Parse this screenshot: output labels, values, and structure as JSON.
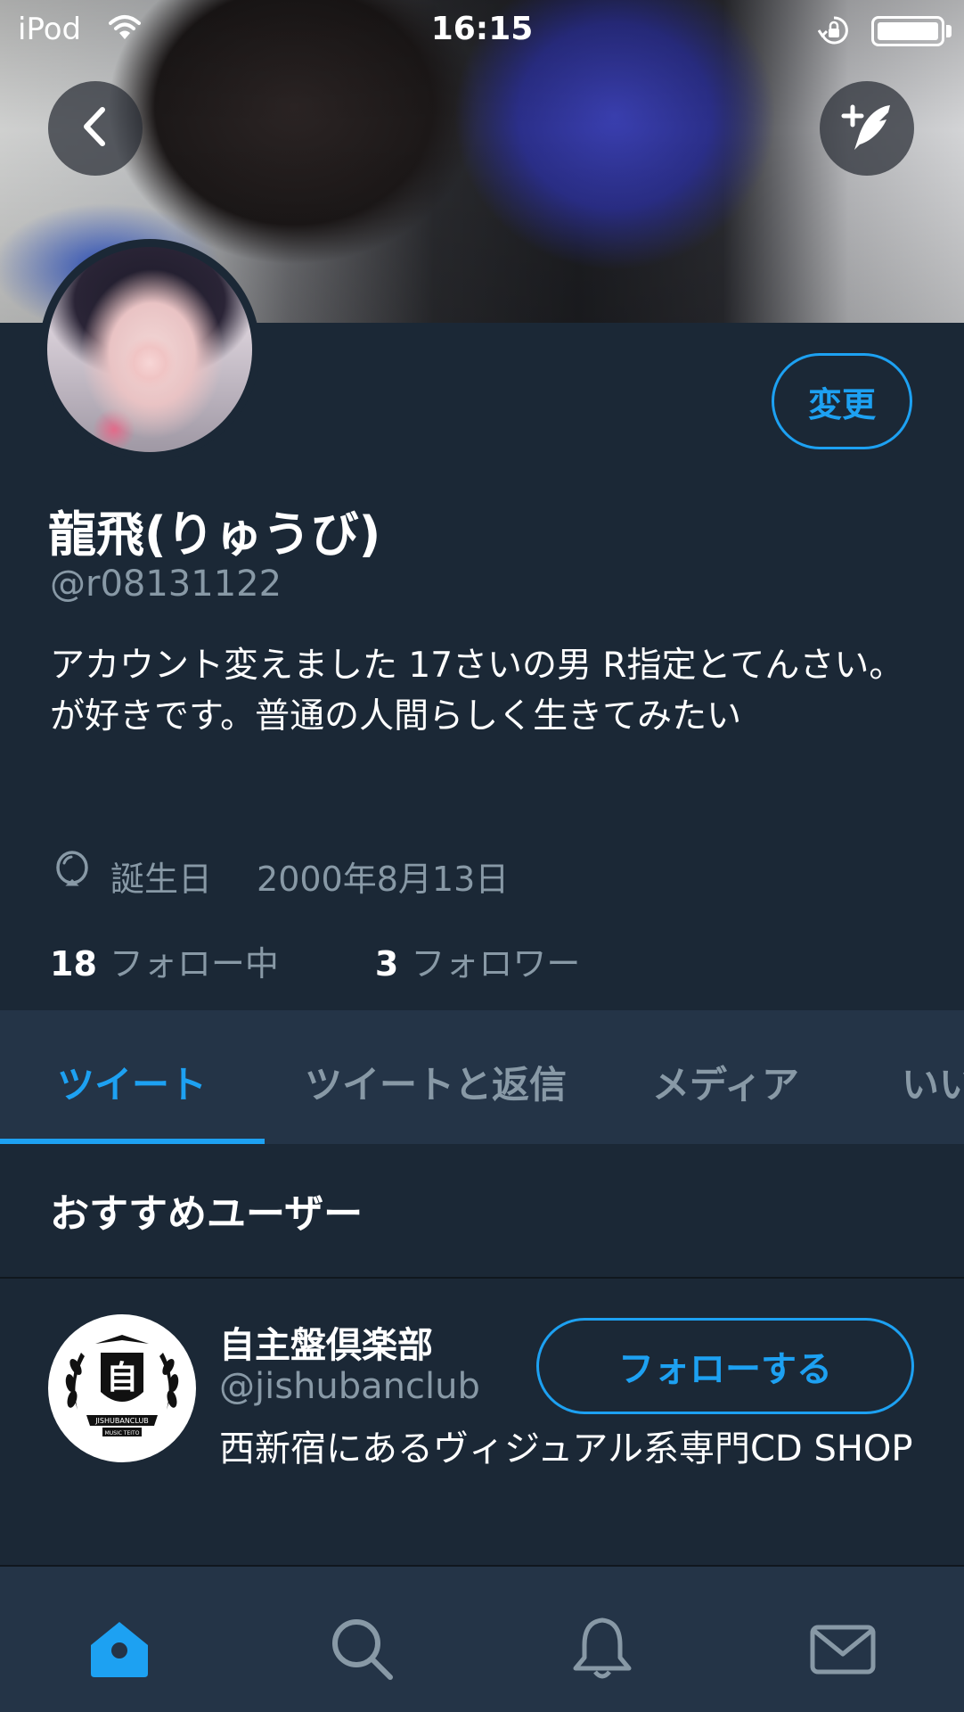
{
  "status_bar": {
    "carrier": "iPod",
    "time": "16:15"
  },
  "header": {
    "back_icon": "chevron-left-icon",
    "compose_icon": "compose-tweet-icon"
  },
  "profile": {
    "change_label": "変更",
    "display_name": "龍飛(りゅうび)",
    "handle": "@r08131122",
    "bio": "アカウント変えました 17さいの男 R指定とてんさい。が好きです。普通の人間らしく生きてみたい",
    "birthday_label": "誕生日",
    "birthday_value": "2000年8月13日",
    "following_count": "18",
    "following_label": "フォロー中",
    "followers_count": "3",
    "followers_label": "フォロワー"
  },
  "tabs": [
    {
      "label": "ツイート",
      "active": true
    },
    {
      "label": "ツイートと返信",
      "active": false
    },
    {
      "label": "メディア",
      "active": false
    },
    {
      "label": "いいね",
      "active": false
    }
  ],
  "recommended": {
    "title": "おすすめユーザー",
    "user": {
      "name": "自主盤倶楽部",
      "handle": "@jishubanclub",
      "bio": "西新宿にあるヴィジュアル系専門CD SHOP",
      "follow_label": "フォローする",
      "logo_char": "自",
      "logo_text": "JISHUBANCLUB",
      "logo_subtext": "MUSIC TEITO"
    }
  },
  "bottom_nav": [
    {
      "icon": "home-icon",
      "active": true
    },
    {
      "icon": "search-icon",
      "active": false
    },
    {
      "icon": "notifications-icon",
      "active": false
    },
    {
      "icon": "messages-icon",
      "active": false
    }
  ],
  "colors": {
    "accent": "#1da1f2",
    "background": "#1b2836",
    "tab_bar": "#243447",
    "secondary_text": "#8899a6"
  }
}
